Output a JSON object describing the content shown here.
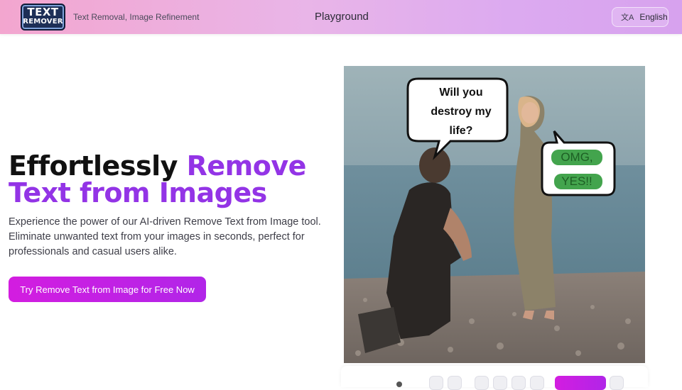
{
  "header": {
    "logo_line1": "TEXT",
    "logo_line2": "REMOVER",
    "tagline": "Text Removal, Image Refinement",
    "nav_playground": "Playground",
    "language_icon": "translate-icon",
    "language_label": "English"
  },
  "hero": {
    "title_plain": "Effortlessly ",
    "title_accent": "Remove Text from Images",
    "description": "Experience the power of our AI-driven Remove Text from Image tool. Eliminate unwanted text from your images in seconds, perfect for professionals and casual users alike.",
    "cta_label": "Try Remove Text from Image for Free Now"
  },
  "image": {
    "bubble_left": [
      "Will you",
      "destroy my",
      "life?"
    ],
    "bubble_right": [
      "OMG,",
      "YES!!"
    ]
  },
  "colors": {
    "accent": "#9334e6",
    "cta": "#c721e4",
    "mask": "#2f9a3a"
  }
}
